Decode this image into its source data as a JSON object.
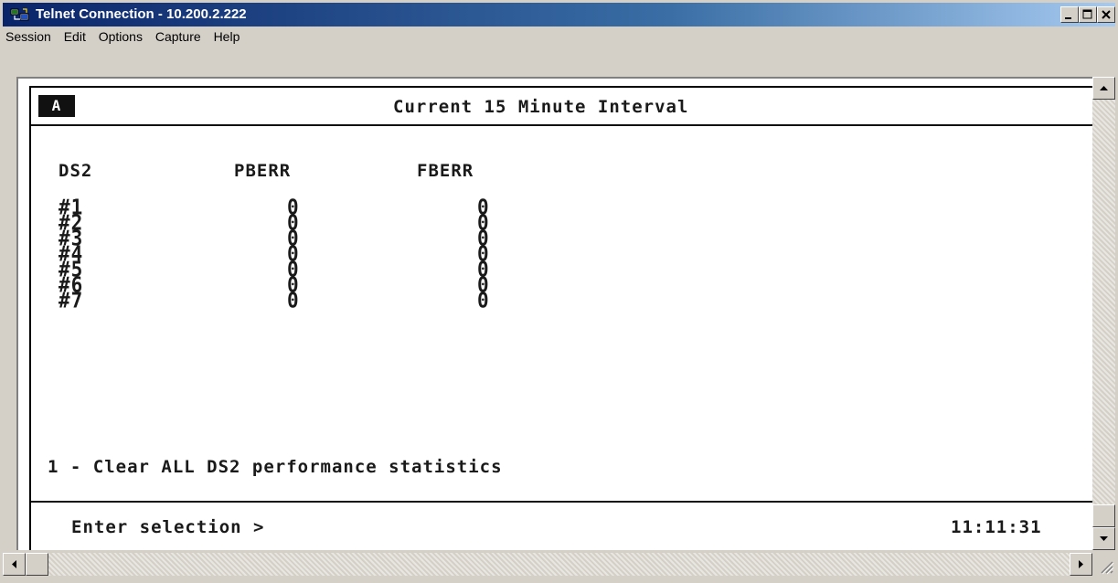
{
  "window": {
    "title": "Telnet Connection - 10.200.2.222"
  },
  "menu": [
    "Session",
    "Edit",
    "Options",
    "Capture",
    "Help"
  ],
  "terminal": {
    "badge": "A",
    "header_title": "Current 15 Minute Interval",
    "columns": [
      "DS2",
      "PBERR",
      "FBERR"
    ],
    "rows": [
      {
        "ds2": "#1",
        "pberr": "0",
        "fberr": "0"
      },
      {
        "ds2": "#2",
        "pberr": "0",
        "fberr": "0"
      },
      {
        "ds2": "#3",
        "pberr": "0",
        "fberr": "0"
      },
      {
        "ds2": "#4",
        "pberr": "0",
        "fberr": "0"
      },
      {
        "ds2": "#5",
        "pberr": "0",
        "fberr": "0"
      },
      {
        "ds2": "#6",
        "pberr": "0",
        "fberr": "0"
      },
      {
        "ds2": "#7",
        "pberr": "0",
        "fberr": "0"
      }
    ],
    "option": "1 - Clear ALL DS2 performance statistics",
    "prompt": "Enter selection >",
    "time": "11:11:31"
  },
  "icons": {
    "app": "telnet-icon",
    "minimize": "minimize-icon",
    "maximize": "maximize-icon",
    "close": "close-icon"
  },
  "colors": {
    "titlebar_start": "#0a246a",
    "titlebar_end": "#a6caf0",
    "chrome": "#d4d0c8",
    "terminal_bg": "#ffffff",
    "terminal_text": "#1a1a1a"
  }
}
